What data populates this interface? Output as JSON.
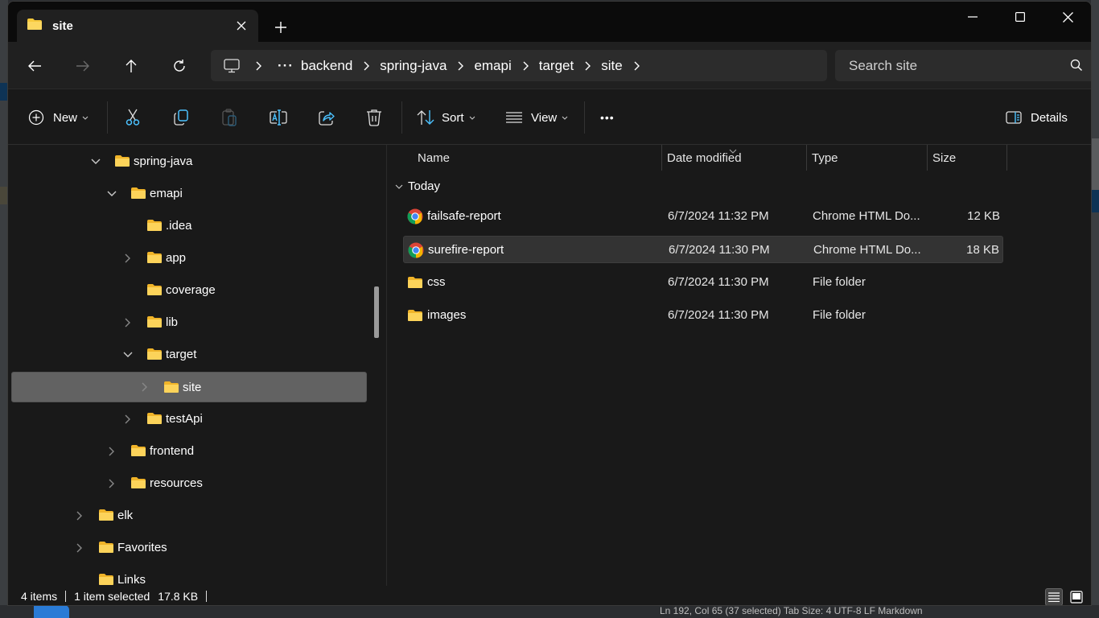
{
  "window": {
    "tab_title": "site",
    "new_tab_label": "+",
    "controls": [
      "minimize",
      "maximize",
      "close"
    ]
  },
  "navigation": {
    "back_icon": "arrow-left-icon",
    "forward_icon": "arrow-right-icon",
    "up_icon": "arrow-up-icon",
    "refresh_icon": "refresh-icon",
    "breadcrumb": [
      "backend",
      "spring-java",
      "emapi",
      "target",
      "site"
    ],
    "overflow_label": "···",
    "search_placeholder": "Search site"
  },
  "toolbar": {
    "new_label": "New",
    "sort_label": "Sort",
    "view_label": "View",
    "more_label": "•••",
    "details_label": "Details",
    "actions": [
      "cut",
      "copy",
      "paste",
      "rename",
      "share",
      "delete"
    ]
  },
  "sidebar": {
    "items": [
      {
        "label": "spring-java",
        "expander": "expanded",
        "level": 3
      },
      {
        "label": "emapi",
        "expander": "expanded",
        "level": 4
      },
      {
        "label": ".idea",
        "expander": "none",
        "level": 5
      },
      {
        "label": "app",
        "expander": "collapsed",
        "level": 5
      },
      {
        "label": "coverage",
        "expander": "none",
        "level": 5
      },
      {
        "label": "lib",
        "expander": "collapsed",
        "level": 5
      },
      {
        "label": "target",
        "expander": "expanded",
        "level": 5
      },
      {
        "label": "site",
        "expander": "collapsed",
        "level": 6,
        "selected": true
      },
      {
        "label": "testApi",
        "expander": "collapsed",
        "level": 5
      },
      {
        "label": "frontend",
        "expander": "collapsed",
        "level": 4
      },
      {
        "label": "resources",
        "expander": "collapsed",
        "level": 4
      },
      {
        "label": "elk",
        "expander": "collapsed",
        "level": 2
      },
      {
        "label": "Favorites",
        "expander": "collapsed",
        "level": 2
      },
      {
        "label": "Links",
        "expander": "none",
        "level": 2
      }
    ]
  },
  "file_list": {
    "columns": {
      "name": "Name",
      "date": "Date modified",
      "type": "Type",
      "size": "Size"
    },
    "group_label": "Today",
    "rows": [
      {
        "name": "failsafe-report",
        "date": "6/7/2024 11:32 PM",
        "type": "Chrome HTML Do...",
        "size": "12 KB",
        "icon": "chrome-icon",
        "selected": false
      },
      {
        "name": "surefire-report",
        "date": "6/7/2024 11:30 PM",
        "type": "Chrome HTML Do...",
        "size": "18 KB",
        "icon": "chrome-icon",
        "selected": true
      },
      {
        "name": "css",
        "date": "6/7/2024 11:30 PM",
        "type": "File folder",
        "size": "",
        "icon": "folder-icon",
        "selected": false
      },
      {
        "name": "images",
        "date": "6/7/2024 11:30 PM",
        "type": "File folder",
        "size": "",
        "icon": "folder-icon",
        "selected": false
      }
    ]
  },
  "status": {
    "item_count": "4 items",
    "selection": "1 item selected",
    "selection_size": "17.8 KB"
  },
  "background": {
    "status_ghost": "Ln 192, Col 65 (37 selected)   Tab Size: 4   UTF-8   LF   Markdown"
  },
  "colors": {
    "accent": "#4cc2ff",
    "folder": "#f8c93b",
    "window_bg": "#191919",
    "selection_bg": "#626262"
  }
}
